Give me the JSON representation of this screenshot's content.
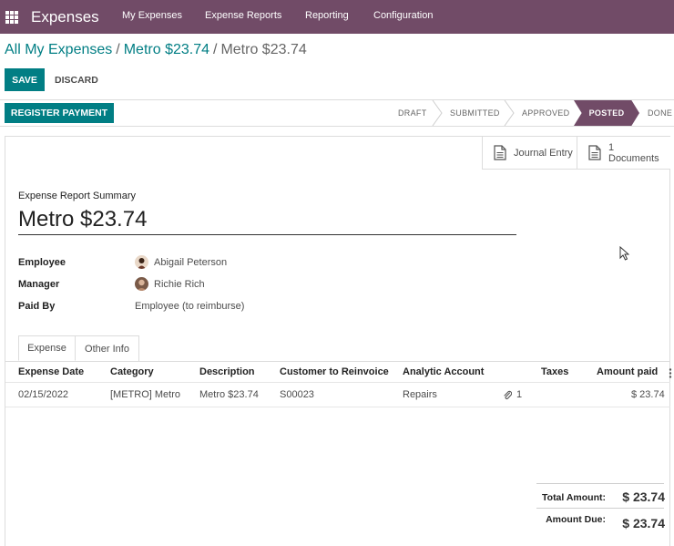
{
  "navbar": {
    "brand": "Expenses",
    "menu": [
      "My Expenses",
      "Expense Reports",
      "Reporting",
      "Configuration"
    ]
  },
  "breadcrumb": {
    "items": [
      "All My Expenses",
      "Metro $23.74",
      "Metro $23.74"
    ],
    "separator": "/"
  },
  "actions": {
    "save": "SAVE",
    "discard": "DISCARD"
  },
  "statusbar": {
    "register_payment": "REGISTER PAYMENT",
    "stages": [
      "DRAFT",
      "SUBMITTED",
      "APPROVED",
      "POSTED",
      "DONE"
    ],
    "active_stage": "POSTED"
  },
  "smart_buttons": {
    "journal_entry": "Journal Entry",
    "documents_count": "1",
    "documents_label": "Documents"
  },
  "form": {
    "summary_label": "Expense Report Summary",
    "title": "Metro $23.74",
    "employee_label": "Employee",
    "employee_value": "Abigail Peterson",
    "manager_label": "Manager",
    "manager_value": "Richie Rich",
    "paid_by_label": "Paid By",
    "paid_by_value": "Employee (to reimburse)"
  },
  "tabs": [
    "Expense",
    "Other Info"
  ],
  "table": {
    "columns": [
      "Expense Date",
      "Category",
      "Description",
      "Customer to Reinvoice",
      "Analytic Account",
      "Taxes",
      "Amount paid"
    ],
    "rows": [
      {
        "date": "02/15/2022",
        "category": "[METRO] Metro",
        "description": "Metro $23.74",
        "customer": "S00023",
        "analytic": "Repairs",
        "attachments": "1",
        "taxes": "",
        "amount": "$ 23.74"
      }
    ]
  },
  "totals": {
    "total_label": "Total Amount:",
    "total_value": "$ 23.74",
    "due_label": "Amount Due:",
    "due_value": "$ 23.74"
  },
  "colors": {
    "brand": "#714b67",
    "primary": "#017e84"
  }
}
